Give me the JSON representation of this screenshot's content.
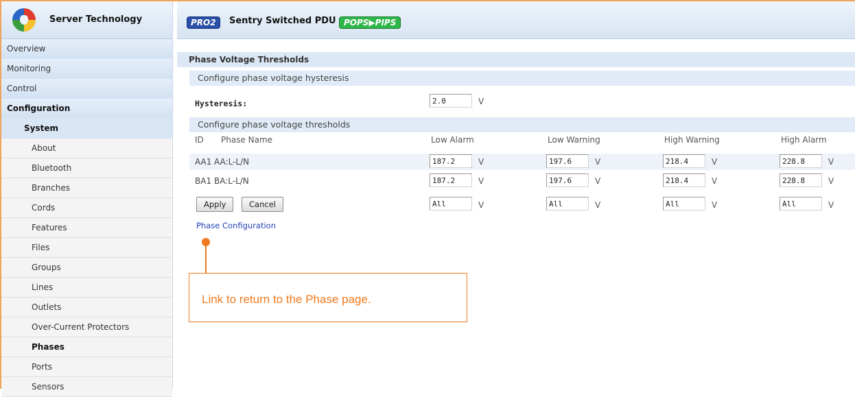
{
  "brand": {
    "name": "Server Technology",
    "logo_icon": "server-technology-logo-icon"
  },
  "header": {
    "pro_badge": "PRO2",
    "product": "Sentry Switched PDU",
    "pops_badge": "POPS▶PIPS"
  },
  "sidebar": {
    "top_items": [
      {
        "label": "Overview"
      },
      {
        "label": "Monitoring"
      },
      {
        "label": "Control"
      },
      {
        "label": "Configuration"
      }
    ],
    "system_label": "System",
    "sub_items": [
      {
        "label": "About"
      },
      {
        "label": "Bluetooth"
      },
      {
        "label": "Branches"
      },
      {
        "label": "Cords"
      },
      {
        "label": "Features"
      },
      {
        "label": "Files"
      },
      {
        "label": "Groups"
      },
      {
        "label": "Lines"
      },
      {
        "label": "Outlets"
      },
      {
        "label": "Over-Current Protectors"
      },
      {
        "label": "Phases"
      },
      {
        "label": "Ports"
      },
      {
        "label": "Sensors"
      }
    ],
    "active_item": "Phases"
  },
  "page": {
    "title": "Phase Voltage Thresholds",
    "hysteresis_section": "Configure phase voltage hysteresis",
    "hysteresis_label": "Hysteresis:",
    "hysteresis_value": "2.0",
    "thresholds_section": "Configure phase voltage thresholds",
    "columns": {
      "id": "ID",
      "phase_name": "Phase Name",
      "low_alarm": "Low Alarm",
      "low_warning": "Low Warning",
      "high_warning": "High Warning",
      "high_alarm": "High Alarm"
    },
    "unit": "V",
    "rows": [
      {
        "id": "AA1",
        "name": "AA:L-L/N",
        "low_alarm": "187.2",
        "low_warning": "197.6",
        "high_warning": "218.4",
        "high_alarm": "228.8"
      },
      {
        "id": "BA1",
        "name": "BA:L-L/N",
        "low_alarm": "187.2",
        "low_warning": "197.6",
        "high_warning": "218.4",
        "high_alarm": "228.8"
      }
    ],
    "all_row": {
      "low_alarm": "All",
      "low_warning": "All",
      "high_warning": "All",
      "high_alarm": "All"
    },
    "apply_label": "Apply",
    "cancel_label": "Cancel",
    "phase_config_link": "Phase Configuration"
  },
  "annotation": {
    "text": "Link to return to the Phase page.",
    "color": "#ef7a1f"
  }
}
